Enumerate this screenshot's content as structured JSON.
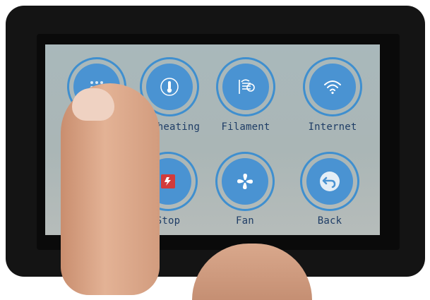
{
  "screen": {
    "buttons": [
      {
        "id": "menu",
        "label": "",
        "icon": "grid-icon"
      },
      {
        "id": "preheating",
        "label": "Preheating",
        "icon": "thermometer-icon"
      },
      {
        "id": "filament",
        "label": "Filament",
        "icon": "filament-spool-icon"
      },
      {
        "id": "internet",
        "label": "Internet",
        "icon": "wifi-icon"
      },
      {
        "id": "stop",
        "label": "Stop",
        "icon": "stop-icon"
      },
      {
        "id": "fan",
        "label": "Fan",
        "icon": "fan-icon"
      },
      {
        "id": "back",
        "label": "Back",
        "icon": "back-arrow-icon"
      }
    ]
  },
  "colors": {
    "ring": "#3f8fcf",
    "button_fill": "#4a93d2",
    "stop_accent": "#d23b3b",
    "label": "#1f3d66",
    "screen_bg": "#aab6b6"
  }
}
